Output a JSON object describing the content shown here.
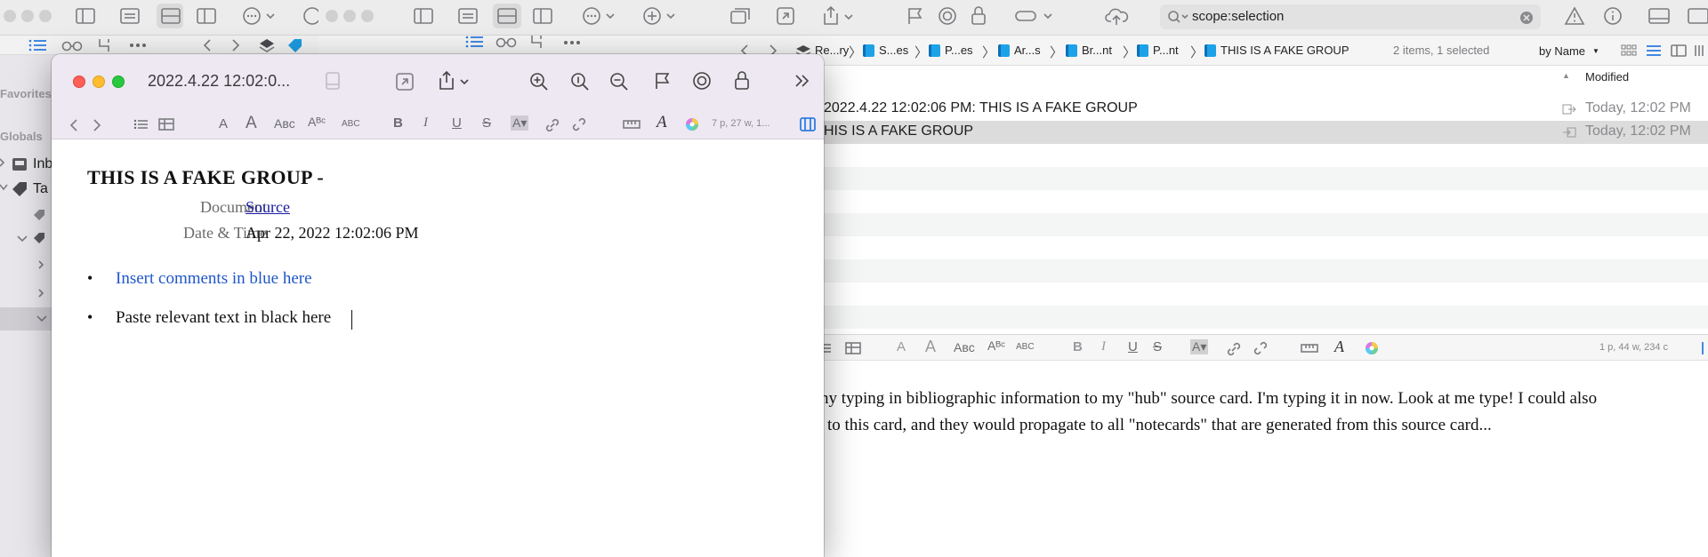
{
  "search": {
    "value": "scope:selection"
  },
  "sidebar": {
    "favorites": "Favorites",
    "globals": "Globals",
    "inbox": "Inb",
    "tags": "Ta"
  },
  "breadcrumb": {
    "items": [
      "Re...ry",
      "S...es",
      "P...es",
      "Ar...s",
      "Br...nt",
      "P...nt",
      "THIS IS A FAKE GROUP"
    ],
    "count": "2 items, 1 selected",
    "sort": "by Name"
  },
  "list": {
    "column_modified": "Modified",
    "rows": [
      {
        "name": "2022.4.22 12:02:06 PM: THIS IS A FAKE GROUP",
        "modified": "Today, 12:02 PM"
      },
      {
        "name": "HIS IS A FAKE GROUP",
        "modified": "Today, 12:02 PM"
      }
    ]
  },
  "editor2": {
    "stats": "1 p, 44 w, 234 c",
    "text_line1": "ny typing in bibliographic information to my \"hub\" source card. I'm typing it in now. Look at me type! I could also",
    "text_line2": "to this card, and they would propagate to all \"notecards\" that are generated from this source card..."
  },
  "front": {
    "title": "2022.4.22 12:02:0...",
    "stats": "7 p, 27 w, 1...",
    "heading": "THIS IS A FAKE GROUP -",
    "doc_label": "Document",
    "doc_value": "Source",
    "date_label": "Date & Time",
    "date_value": "Apr 22, 2022 12:02:06 PM",
    "bullet1": "Insert comments in blue here",
    "bullet2": "Paste relevant text in black here"
  },
  "colors": {
    "accent": "#2f7de1",
    "comment_blue": "#1f56c9",
    "link_blue": "#1a1ad6",
    "selection_row": "#dcdcdc"
  }
}
